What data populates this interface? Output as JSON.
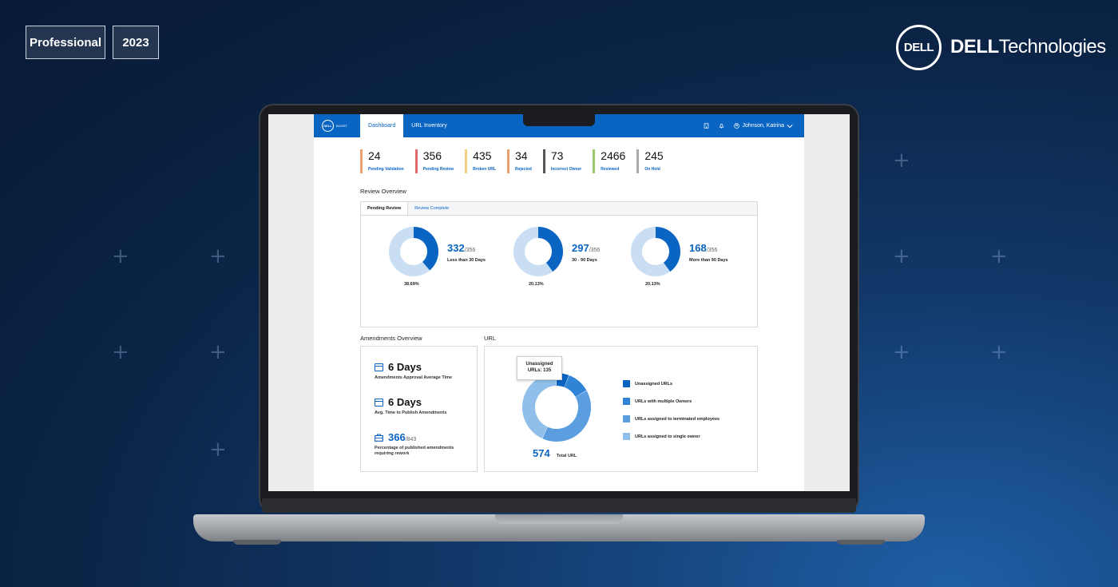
{
  "badges": {
    "level": "Professional",
    "year": "2023"
  },
  "brand": {
    "circle_logo": "DELL",
    "wordmark_bold": "DELL",
    "wordmark_rest": "Technologies"
  },
  "app": {
    "logo_text": "DELL",
    "logo_sub": "BOOST",
    "tabs": [
      {
        "label": "Dashboard",
        "active": true
      },
      {
        "label": "URL Inventory",
        "active": false
      }
    ],
    "user": "Johnson, Katrina",
    "icons": [
      "building-icon",
      "bell-icon",
      "user-icon",
      "chevron-down-icon"
    ]
  },
  "stats": [
    {
      "value": "24",
      "label": "Pending Validation",
      "color": "#f0a070"
    },
    {
      "value": "356",
      "label": "Pending Review",
      "color": "#e06a6a"
    },
    {
      "value": "435",
      "label": "Broken URL",
      "color": "#f5d080"
    },
    {
      "value": "34",
      "label": "Rejected",
      "color": "#e8a070"
    },
    {
      "value": "73",
      "label": "Incorrect Owner",
      "color": "#555555"
    },
    {
      "value": "2466",
      "label": "Reviewed",
      "color": "#9bc96a"
    },
    {
      "value": "245",
      "label": "On Hold",
      "color": "#aaaaaa"
    }
  ],
  "review": {
    "title": "Review Overview",
    "tabs": [
      "Pending Review",
      "Review Complete"
    ],
    "items": [
      {
        "value": "332",
        "total": "/356",
        "label": "Less than 30 Days",
        "pct": "38.69%",
        "fraction": 0.3869
      },
      {
        "value": "297",
        "total": "/356",
        "label": "30 -  90 Days",
        "pct": "20.13%",
        "fraction": 0.4
      },
      {
        "value": "168",
        "total": "/356",
        "label": "More than 90 Days",
        "pct": "20.13%",
        "fraction": 0.4
      }
    ]
  },
  "amendments": {
    "title": "Amendments Overview",
    "items": [
      {
        "value": "6 Days",
        "label": "Amendments Approval Average Time"
      },
      {
        "value": "6 Days",
        "label": "Avg. Time to Publish Amendments"
      },
      {
        "value": "366",
        "den": "/843",
        "label": "Percentage of published amendments requiring rework"
      }
    ]
  },
  "url": {
    "title": "URL",
    "tooltip_line1": "Unassigned",
    "tooltip_line2": "URLs: 135",
    "total": "574",
    "total_label": "Total URL",
    "legend": [
      {
        "label": "Unassigned URLs",
        "color": "#0a64c2"
      },
      {
        "label": "URLs with multiple Owners",
        "color": "#2f84d6"
      },
      {
        "label": "URLs assigned to terminated employees",
        "color": "#5a9ee0"
      },
      {
        "label": "URLs assigned to single owner",
        "color": "#8fbfea"
      }
    ]
  },
  "colors": {
    "primary": "#0a64c2",
    "donut_track": "#c9def2"
  }
}
